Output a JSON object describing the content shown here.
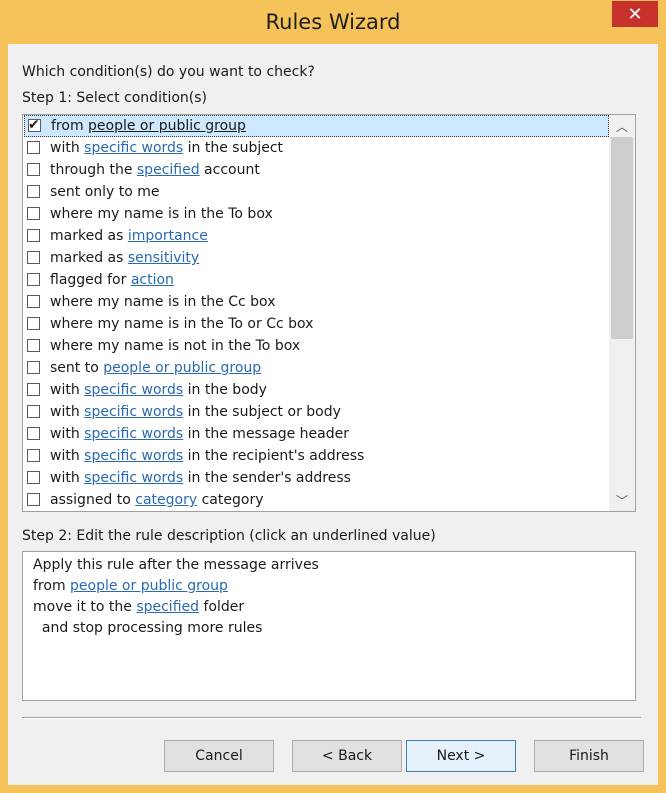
{
  "window": {
    "title": "Rules Wizard",
    "close_glyph": "✕"
  },
  "prompt": "Which condition(s) do you want to check?",
  "step1_label": "Step 1: Select condition(s)",
  "conditions": [
    {
      "checked": true,
      "parts": [
        {
          "t": "from "
        },
        {
          "t": "people or public group",
          "link": true
        }
      ]
    },
    {
      "checked": false,
      "parts": [
        {
          "t": "with "
        },
        {
          "t": "specific words",
          "link": true
        },
        {
          "t": " in the subject"
        }
      ]
    },
    {
      "checked": false,
      "parts": [
        {
          "t": "through the "
        },
        {
          "t": "specified",
          "link": true
        },
        {
          "t": " account"
        }
      ]
    },
    {
      "checked": false,
      "parts": [
        {
          "t": "sent only to me"
        }
      ]
    },
    {
      "checked": false,
      "parts": [
        {
          "t": "where my name is in the To box"
        }
      ]
    },
    {
      "checked": false,
      "parts": [
        {
          "t": "marked as "
        },
        {
          "t": "importance",
          "link": true
        }
      ]
    },
    {
      "checked": false,
      "parts": [
        {
          "t": "marked as "
        },
        {
          "t": "sensitivity",
          "link": true
        }
      ]
    },
    {
      "checked": false,
      "parts": [
        {
          "t": "flagged for "
        },
        {
          "t": "action",
          "link": true
        }
      ]
    },
    {
      "checked": false,
      "parts": [
        {
          "t": "where my name is in the Cc box"
        }
      ]
    },
    {
      "checked": false,
      "parts": [
        {
          "t": "where my name is in the To or Cc box"
        }
      ]
    },
    {
      "checked": false,
      "parts": [
        {
          "t": "where my name is not in the To box"
        }
      ]
    },
    {
      "checked": false,
      "parts": [
        {
          "t": "sent to "
        },
        {
          "t": "people or public group",
          "link": true
        }
      ]
    },
    {
      "checked": false,
      "parts": [
        {
          "t": "with "
        },
        {
          "t": "specific words",
          "link": true
        },
        {
          "t": " in the body"
        }
      ]
    },
    {
      "checked": false,
      "parts": [
        {
          "t": "with "
        },
        {
          "t": "specific words",
          "link": true
        },
        {
          "t": " in the subject or body"
        }
      ]
    },
    {
      "checked": false,
      "parts": [
        {
          "t": "with "
        },
        {
          "t": "specific words",
          "link": true
        },
        {
          "t": " in the message header"
        }
      ]
    },
    {
      "checked": false,
      "parts": [
        {
          "t": "with "
        },
        {
          "t": "specific words",
          "link": true
        },
        {
          "t": " in the recipient's address"
        }
      ]
    },
    {
      "checked": false,
      "parts": [
        {
          "t": "with "
        },
        {
          "t": "specific words",
          "link": true
        },
        {
          "t": " in the sender's address"
        }
      ]
    },
    {
      "checked": false,
      "parts": [
        {
          "t": "assigned to "
        },
        {
          "t": "category",
          "link": true
        },
        {
          "t": " category"
        }
      ]
    }
  ],
  "step2_label": "Step 2: Edit the rule description (click an underlined value)",
  "description": [
    {
      "parts": [
        {
          "t": "Apply this rule after the message arrives"
        }
      ]
    },
    {
      "parts": [
        {
          "t": "from "
        },
        {
          "t": "people or public group",
          "link": true
        }
      ]
    },
    {
      "parts": [
        {
          "t": "move it to the "
        },
        {
          "t": "specified",
          "link": true
        },
        {
          "t": " folder"
        }
      ]
    },
    {
      "parts": [
        {
          "t": "  and stop processing more rules"
        }
      ]
    }
  ],
  "buttons": {
    "cancel": "Cancel",
    "back": "< Back",
    "next": "Next >",
    "finish": "Finish"
  },
  "scrollbar": {
    "up_glyph": "︿",
    "down_glyph": "﹀"
  },
  "colors": {
    "titlebar": "#f5c35a",
    "close": "#c7312b",
    "link": "#2a6ab0",
    "selection": "#cde8ff"
  }
}
